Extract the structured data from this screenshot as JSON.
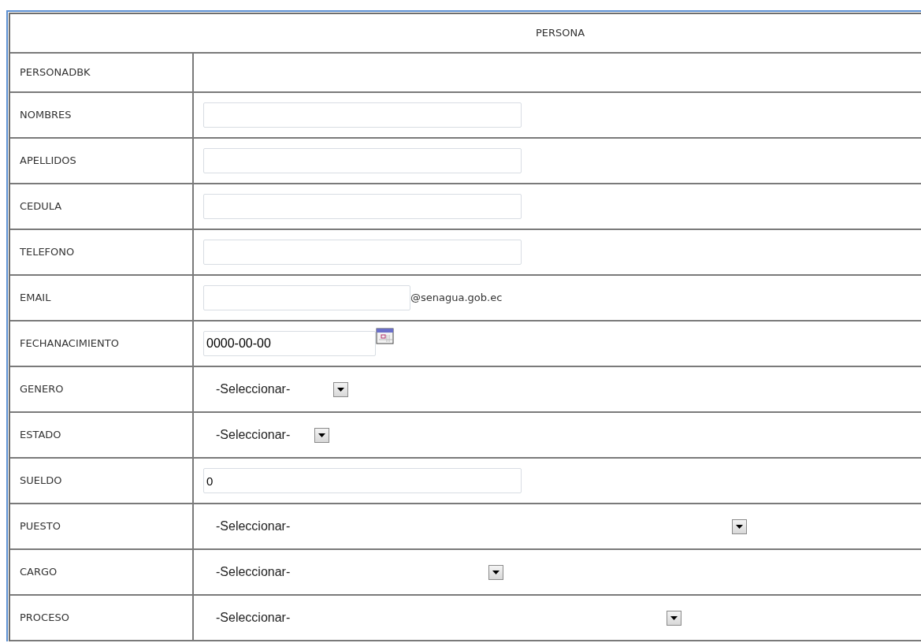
{
  "form": {
    "title": "PERSONA",
    "rows": [
      {
        "label": "PERSONADBK",
        "kind": "empty"
      },
      {
        "label": "NOMBRES",
        "kind": "text",
        "value": ""
      },
      {
        "label": "APELLIDOS",
        "kind": "text",
        "value": ""
      },
      {
        "label": "CEDULA",
        "kind": "text",
        "value": ""
      },
      {
        "label": "TELEFONO",
        "kind": "text",
        "value": ""
      },
      {
        "label": "EMAIL",
        "kind": "email",
        "value": "",
        "suffix": "@senagua.gob.ec"
      },
      {
        "label": "FECHANACIMIENTO",
        "kind": "date",
        "value": "0000-00-00"
      },
      {
        "label": "GENERO",
        "kind": "select",
        "value": "-Seleccionar-"
      },
      {
        "label": "ESTADO",
        "kind": "select",
        "value": "-Seleccionar-"
      },
      {
        "label": "SUELDO",
        "kind": "text",
        "value": "0"
      },
      {
        "label": "PUESTO",
        "kind": "select",
        "value": "-Seleccionar-"
      },
      {
        "label": "CARGO",
        "kind": "select",
        "value": "-Seleccionar-"
      },
      {
        "label": "PROCESO",
        "kind": "select",
        "value": "-Seleccionar-"
      }
    ]
  }
}
